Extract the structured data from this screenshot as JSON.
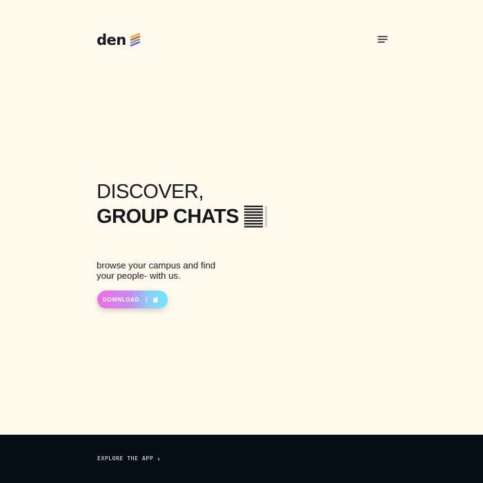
{
  "header": {
    "logo_text": "den",
    "menu_icon": "hamburger-menu-icon"
  },
  "hero": {
    "line1": "DISCOVER,",
    "line2": "GROUP CHATS",
    "line2_icon": "striped-lines-icon"
  },
  "tagline": "browse your campus and find your people- with us.",
  "download_button": {
    "label": "DOWNLOAD",
    "separator": "|",
    "icon": "apple-icon"
  },
  "footer": {
    "explore_label": "EXPLORE THE APP ↓"
  },
  "colors": {
    "background": "#fffaee",
    "text": "#14171c",
    "footer_background": "#050d16",
    "gradient_start": "#f06fe0",
    "gradient_end": "#6fe6fb",
    "logo_stripes": [
      "#f5a623",
      "#e8456b",
      "#3fbf6b",
      "#8e44e8"
    ]
  }
}
